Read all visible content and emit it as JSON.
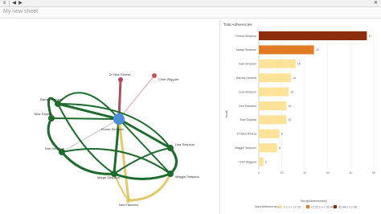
{
  "app": {
    "sheet_title": "My new sheet"
  },
  "toolbar": {
    "buttons": [
      {
        "name": "menu",
        "glyph": "≡"
      },
      {
        "name": "undo",
        "glyph": "◀"
      },
      {
        "name": "redo",
        "glyph": "▶"
      },
      {
        "name": "close",
        "glyph": "✕"
      }
    ]
  },
  "network": {
    "nodes": [
      {
        "id": "homer",
        "label": "Homer Simpson",
        "color": "#4a90d9"
      },
      {
        "id": "dr",
        "label": "Dr Nick Riviera",
        "color": "#b5455a"
      },
      {
        "id": "chief",
        "label": "Chief Wiggum",
        "color": "#c9515f"
      },
      {
        "id": "barney",
        "label": "Barney Gumble",
        "color": "#1e6b2e"
      },
      {
        "id": "moe",
        "label": "Moe Szyslak",
        "color": "#1e6b2e"
      },
      {
        "id": "bart",
        "label": "Bart Simpson",
        "color": "#1e6b2e"
      },
      {
        "id": "lisa",
        "label": "Lisa Simpson",
        "color": "#1e6b2e"
      },
      {
        "id": "marge",
        "label": "Marge Simpson",
        "color": "#1e6b2e"
      },
      {
        "id": "ned",
        "label": "Ned Flanders",
        "color": "#1e6b2e"
      },
      {
        "id": "maggie",
        "label": "Maggie Simpson",
        "color": "#1e6b2e"
      }
    ],
    "edge_colors": {
      "strong": "#1e6b2e",
      "medium": "#e3c96a",
      "weak": "#c9515f",
      "dr": "#a85060"
    }
  },
  "chart_data": {
    "type": "bar",
    "orientation": "horizontal",
    "title": "Total Adherencies",
    "xlabel": "Sum(Adherencies)",
    "ylabel": "Node",
    "categories": [
      "Homer Simpson",
      "Marge Simpson",
      "Bart Simpson",
      "Barney Gumble",
      "Lisa Simpson",
      "Ned Flanders",
      "Moe Szyslak",
      "Dr Nick Riviera",
      "Maggie Simpson",
      "Chief Wiggum"
    ],
    "values": [
      47,
      24,
      16,
      14,
      13,
      12,
      12,
      9,
      8,
      2
    ],
    "colors": [
      "#8b2c0a",
      "#e07b24",
      "#fde29a",
      "#fde29a",
      "#fde29a",
      "#fde29a",
      "#fde29a",
      "#fde29a",
      "#fde29a",
      "#fde29a"
    ],
    "xlim": [
      0,
      50
    ],
    "xticks": [
      0,
      10,
      20,
      30,
      40,
      50
    ],
    "legend": {
      "title": "Sum(Adherencies)",
      "items": [
        {
          "label": "2 ≤ x < 17.22",
          "color": "#fde29a"
        },
        {
          "label": "17.22 ≤ x < 32.44",
          "color": "#e07b24"
        },
        {
          "label": "32.44 ≤ x ≤ 48",
          "color": "#8b2c0a"
        }
      ]
    },
    "grid": true
  }
}
